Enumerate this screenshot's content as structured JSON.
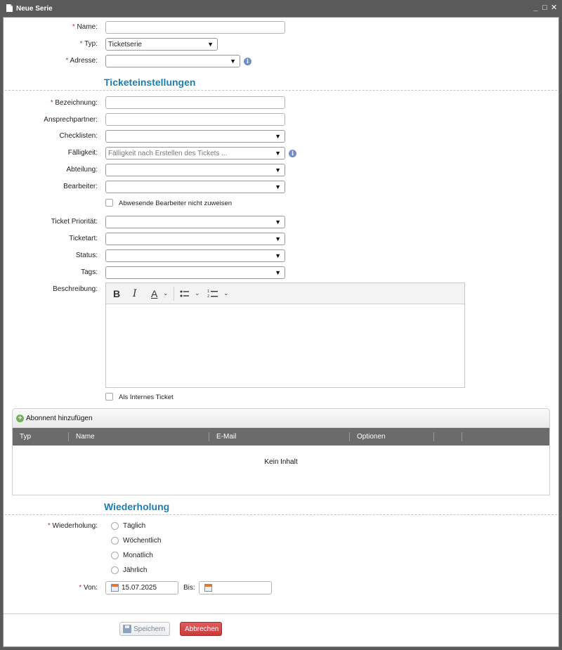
{
  "window": {
    "title": "Neue Serie",
    "controls": {
      "minimize": "_",
      "maximize": "□",
      "close": "✕"
    }
  },
  "form": {
    "name": {
      "label": "Name:",
      "required": "*",
      "value": ""
    },
    "typ": {
      "label": "Typ:",
      "required": "*",
      "value": "Ticketserie"
    },
    "adresse": {
      "label": "Adresse:",
      "required": "*",
      "value": ""
    }
  },
  "ticket_settings": {
    "title": "Ticketeinstellungen",
    "bezeichnung": {
      "label": "Bezeichnung:",
      "required": "*",
      "value": ""
    },
    "ansprechpartner": {
      "label": "Ansprechpartner:",
      "value": ""
    },
    "checklisten": {
      "label": "Checklisten:",
      "value": ""
    },
    "faelligkeit": {
      "label": "Fälligkeit:",
      "placeholder": "Fälligkeit nach Erstellen des Tickets ..."
    },
    "abteilung": {
      "label": "Abteilung:",
      "value": ""
    },
    "bearbeiter": {
      "label": "Bearbeiter:",
      "value": ""
    },
    "abwesende_checkbox": {
      "label": "Abwesende Bearbeiter nicht zuweisen",
      "checked": false
    },
    "prioritaet": {
      "label": "Ticket Priorität:",
      "value": ""
    },
    "ticketart": {
      "label": "Ticketart:",
      "value": ""
    },
    "status": {
      "label": "Status:",
      "value": ""
    },
    "tags": {
      "label": "Tags:",
      "value": ""
    },
    "beschreibung": {
      "label": "Beschreibung:",
      "value": ""
    },
    "internes_ticket": {
      "label": "Als Internes Ticket",
      "checked": false
    }
  },
  "editor_toolbar": {
    "bold": "B",
    "italic": "I",
    "font_color": "A",
    "chevron": "⌄"
  },
  "subscribers": {
    "add_label": "Abonnent hinzufügen",
    "columns": [
      "Typ",
      "Name",
      "E-Mail",
      "Optionen"
    ],
    "empty_text": "Kein Inhalt"
  },
  "recurrence": {
    "title": "Wiederholung",
    "label": "Wiederholung:",
    "required": "*",
    "options": [
      "Täglich",
      "Wöchentlich",
      "Monatlich",
      "Jährlich"
    ],
    "von": {
      "label": "Von:",
      "required": "*",
      "value": "15.07.2025"
    },
    "bis": {
      "label": "Bis:",
      "value": ""
    }
  },
  "buttons": {
    "save": "Speichern",
    "cancel": "Abbrechen"
  },
  "colors": {
    "section_title": "#1d7fb0",
    "required": "#c0392b",
    "cancel": "#c83a3a",
    "header": "#6b6b6b"
  }
}
